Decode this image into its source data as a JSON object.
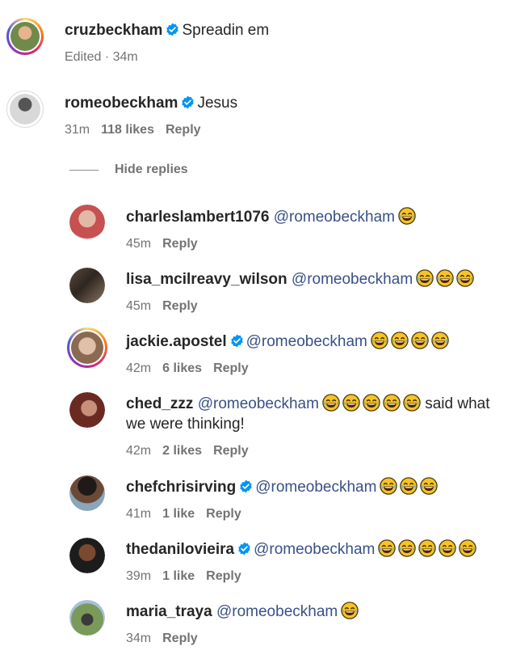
{
  "colors": {
    "mention": "#385185",
    "verified": "#0095f6",
    "meta": "#737373"
  },
  "comments": [
    {
      "username": "cruzbeckham",
      "verified": true,
      "text": "Spreadin em",
      "meta_time": "Edited · 34m",
      "likes": "",
      "reply": ""
    },
    {
      "username": "romeobeckham",
      "verified": true,
      "text": "Jesus",
      "meta_time": "31m",
      "likes": "118 likes",
      "reply": "Reply"
    }
  ],
  "hide_replies": "Hide replies",
  "replies": [
    {
      "username": "charleslambert1076",
      "verified": false,
      "mention": "@romeobeckham",
      "emoji_count": 1,
      "time": "45m",
      "likes": "",
      "reply": "Reply"
    },
    {
      "username": "lisa_mcilreavy_wilson",
      "verified": false,
      "mention": "@romeobeckham",
      "emoji_count": 3,
      "time": "45m",
      "likes": "",
      "reply": "Reply"
    },
    {
      "username": "jackie.apostel",
      "verified": true,
      "mention": "@romeobeckham",
      "emoji_count": 4,
      "time": "42m",
      "likes": "6 likes",
      "reply": "Reply"
    },
    {
      "username": "ched_zzz",
      "verified": false,
      "mention": "@romeobeckham",
      "emoji_count": 5,
      "text_after": "said what",
      "text_line2": "we were thinking!",
      "time": "42m",
      "likes": "2 likes",
      "reply": "Reply"
    },
    {
      "username": "chefchrisirving",
      "verified": true,
      "mention": "@romeobeckham",
      "emoji_count": 3,
      "time": "41m",
      "likes": "1 like",
      "reply": "Reply"
    },
    {
      "username": "thedanilovieira",
      "verified": true,
      "mention": "@romeobeckham",
      "emoji_count": 5,
      "time": "39m",
      "likes": "1 like",
      "reply": "Reply"
    },
    {
      "username": "maria_traya",
      "verified": false,
      "mention": "@romeobeckham",
      "emoji_count": 1,
      "time": "34m",
      "likes": "",
      "reply": "Reply"
    }
  ],
  "emoji_name": "face-with-tears-of-joy"
}
